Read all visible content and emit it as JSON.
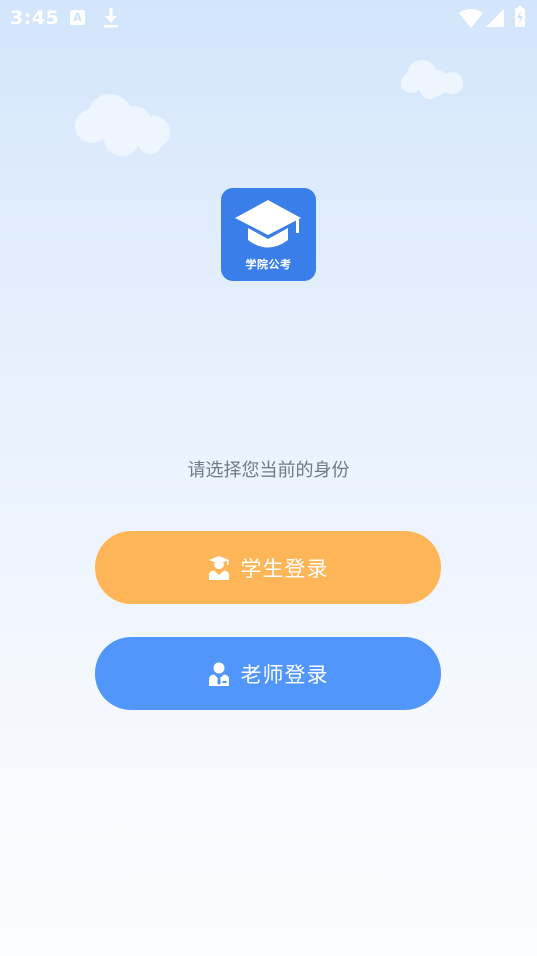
{
  "status_bar": {
    "time": "3:45",
    "notification_icons": [
      "a-app-icon",
      "download-icon"
    ],
    "system_icons": [
      "wifi-icon",
      "cellular-signal-icon",
      "battery-charging-icon"
    ],
    "a_icon_glyph": "A"
  },
  "app": {
    "logo_caption": "学院公考",
    "logo_icon": "graduation-cap-icon"
  },
  "prompt": "请选择您当前的身份",
  "buttons": {
    "student": {
      "label": "学生登录",
      "icon": "student-icon",
      "color": "#ffb659"
    },
    "teacher": {
      "label": "老师登录",
      "icon": "teacher-icon",
      "color": "#5096fb"
    }
  },
  "colors": {
    "logo_bg": "#3a7ee9",
    "background_top": "#d3e5fc",
    "background_bottom": "#fbfcff",
    "prompt_text": "#707a86"
  }
}
